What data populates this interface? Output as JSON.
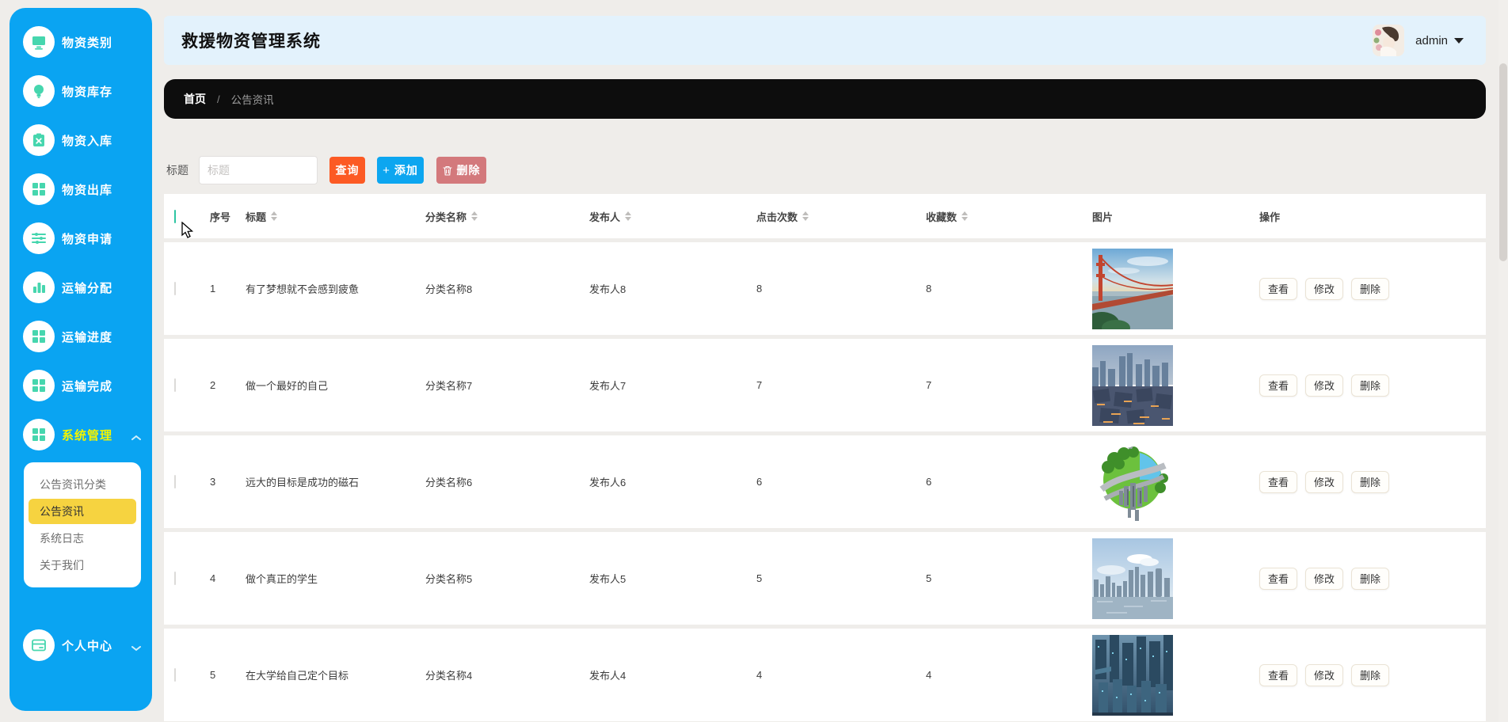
{
  "app": {
    "title": "救援物资管理系统",
    "user": "admin"
  },
  "colors": {
    "sidebar_blue": "#0aa4f2",
    "icon_teal": "#46d6ae",
    "active_yellow": "#f2f400",
    "submenu_selected_gold": "#f6d340",
    "header_light_blue": "#e3f2fc",
    "breadcrumb_black": "#0d0d0d",
    "search_orange": "#fc5a24",
    "add_blue": "#0ca6f0",
    "delete_red": "#d3797c",
    "page_bg": "#efedea"
  },
  "sidebar": {
    "items": [
      {
        "label": "物资类别",
        "icon": "monitor-icon"
      },
      {
        "label": "物资库存",
        "icon": "bulb-icon"
      },
      {
        "label": "物资入库",
        "icon": "clipboard-icon"
      },
      {
        "label": "物资出库",
        "icon": "grid-icon"
      },
      {
        "label": "物资申请",
        "icon": "sliders-icon"
      },
      {
        "label": "运输分配",
        "icon": "bar-chart-icon"
      },
      {
        "label": "运输进度",
        "icon": "grid-icon"
      },
      {
        "label": "运输完成",
        "icon": "grid-icon"
      },
      {
        "label": "系统管理",
        "icon": "grid-icon",
        "active": true,
        "expanded": true
      }
    ],
    "submenu": {
      "items": [
        {
          "label": "公告资讯分类",
          "selected": false
        },
        {
          "label": "公告资讯",
          "selected": true
        },
        {
          "label": "系统日志",
          "selected": false
        },
        {
          "label": "关于我们",
          "selected": false
        }
      ]
    },
    "bottom_item": {
      "label": "个人中心",
      "icon": "card-icon"
    }
  },
  "breadcrumb": {
    "home": "首页",
    "separator": "/",
    "current": "公告资讯"
  },
  "filter": {
    "label": "标题",
    "input_placeholder": "标题",
    "input_value": "",
    "search_label": "查询",
    "add_icon": "+",
    "add_label": "添加",
    "delete_label": "删除"
  },
  "table": {
    "columns": [
      "序号",
      "标题",
      "分类名称",
      "发布人",
      "点击次数",
      "收藏数",
      "图片",
      "操作"
    ],
    "actions": [
      "查看",
      "修改",
      "删除"
    ],
    "rows": [
      {
        "no": "1",
        "title": "有了梦想就不会感到疲惫",
        "category": "分类名称8",
        "publisher": "发布人8",
        "clicks": "8",
        "favs": "8",
        "image": "golden-gate-bridge"
      },
      {
        "no": "2",
        "title": "做一个最好的自己",
        "category": "分类名称7",
        "publisher": "发布人7",
        "clicks": "7",
        "favs": "7",
        "image": "city-at-dusk"
      },
      {
        "no": "3",
        "title": "远大的目标是成功的磁石",
        "category": "分类名称6",
        "publisher": "发布人6",
        "clicks": "6",
        "favs": "6",
        "image": "eco-globe"
      },
      {
        "no": "4",
        "title": "做个真正的学生",
        "category": "分类名称5",
        "publisher": "发布人5",
        "clicks": "5",
        "favs": "5",
        "image": "city-skyline"
      },
      {
        "no": "5",
        "title": "在大学给自己定个目标",
        "category": "分类名称4",
        "publisher": "发布人4",
        "clicks": "4",
        "favs": "4",
        "image": "futuristic-city"
      }
    ]
  }
}
